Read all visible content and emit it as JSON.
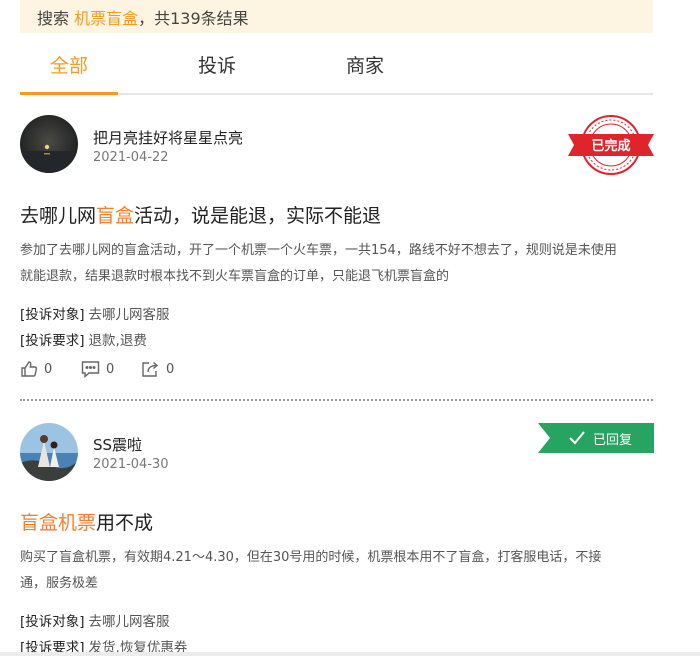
{
  "search": {
    "prefix": "搜索",
    "keyword": "机票盲盒",
    "suffix": "，共139条结果"
  },
  "tabs": [
    {
      "label": "全部",
      "active": true
    },
    {
      "label": "投诉",
      "active": false
    },
    {
      "label": "商家",
      "active": false
    }
  ],
  "posts": [
    {
      "username": "把月亮挂好将星星点亮",
      "date": "2021-04-22",
      "status": "已完成",
      "title_parts": [
        "去哪儿网",
        "盲盒",
        "活动，说是能退，实际不能退"
      ],
      "body_lines": [
        "参加了去哪儿网的盲盒活动，开了一个机票一个火车票，一共154，路线不好不想去了，规则说是未使用",
        "就能退款，结果退款时根本找不到火车票盲盒的订单，只能退飞机票盲盒的"
      ],
      "target_label": "[投诉对象]",
      "target_value": "去哪儿网客服",
      "demand_label": "[投诉要求]",
      "demand_value": "退款,退费",
      "likes": "0",
      "comments": "0",
      "shares": "0"
    },
    {
      "username": "SS震啦",
      "date": "2021-04-30",
      "status": "已回复",
      "title_parts": [
        "",
        "盲盒机票",
        "用不成"
      ],
      "body_lines": [
        "购买了盲盒机票，有效期4.21～4.30，但在30号用的时候，机票根本用不了盲盒，打客服电话，不接",
        "通，服务极差"
      ],
      "target_label": "[投诉对象]",
      "target_value": "去哪儿网客服",
      "demand_label": "[投诉要求]",
      "demand_value": "发货,恢复优惠券"
    }
  ],
  "colors": {
    "accent": "#f59a23",
    "highlight": "#f57f2a",
    "stamp_red": "#e0242b",
    "replied_green": "#27a560",
    "banner_bg": "#fdf5e1"
  },
  "icons": [
    "thumbs-up-icon",
    "comment-icon",
    "share-icon",
    "check-icon"
  ]
}
